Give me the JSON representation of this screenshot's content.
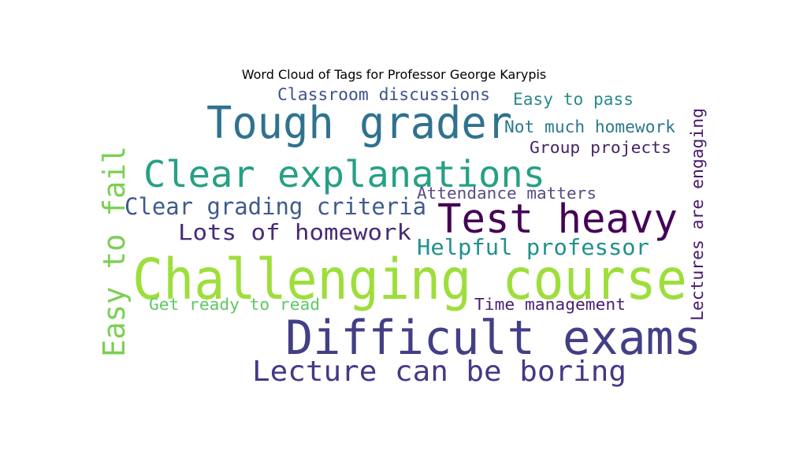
{
  "chart_data": {
    "type": "wordcloud",
    "title": "Word Cloud of Tags for Professor George Karypis",
    "words": [
      {
        "text": "Challenging course",
        "color": "#9ede3c"
      },
      {
        "text": "Difficult exams",
        "color": "#433f86"
      },
      {
        "text": "Tough grader",
        "color": "#30728e"
      },
      {
        "text": "Clear explanations",
        "color": "#26a085"
      },
      {
        "text": "Test heavy",
        "color": "#440256"
      },
      {
        "text": "Easy to fail",
        "color": "#7ad053"
      },
      {
        "text": "Lecture can be boring",
        "color": "#453886"
      },
      {
        "text": "Clear grading criteria",
        "color": "#3e5b8b"
      },
      {
        "text": "Lots of homework",
        "color": "#482a78"
      },
      {
        "text": "Helpful professor",
        "color": "#21918c"
      },
      {
        "text": "Classroom discussions",
        "color": "#3d538b"
      },
      {
        "text": "Not much homework",
        "color": "#2b788e"
      },
      {
        "text": "Easy to pass",
        "color": "#2b8a8c"
      },
      {
        "text": "Group projects",
        "color": "#452566"
      },
      {
        "text": "Attendance matters",
        "color": "#5a4c86"
      },
      {
        "text": "Lectures are engaging",
        "color": "#481a6c"
      },
      {
        "text": "Get ready to read",
        "color": "#5dc863"
      },
      {
        "text": "Time management",
        "color": "#482173"
      }
    ]
  }
}
